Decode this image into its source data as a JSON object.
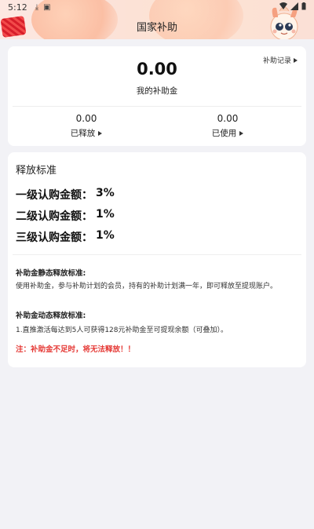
{
  "status_bar": {
    "time": "5:12"
  },
  "header": {
    "title": "国家补助"
  },
  "summary": {
    "history_label": "补助记录",
    "total_amount": "0.00",
    "total_label": "我的补助金",
    "released": {
      "value": "0.00",
      "label": "已释放"
    },
    "used": {
      "value": "0.00",
      "label": "已使用"
    }
  },
  "rules": {
    "title": "释放标准",
    "levels": [
      {
        "label": "一级认购金额：",
        "value": "3%"
      },
      {
        "label": "二级认购金额：",
        "value": "1%"
      },
      {
        "label": "三级认购金额：",
        "value": "1%"
      }
    ],
    "static_heading": "补助金静态释放标准:",
    "static_text": "使用补助金，参与补助计划的会员，持有的补助计划满一年，即可释放至提现账户。",
    "dynamic_heading": "补助金动态释放标准:",
    "dynamic_text": "1.直推激活每达到5人可获得128元补助金至可提现余额（可叠加）。",
    "warning": "注：补助金不足时，将无法释放！！"
  },
  "colors": {
    "background": "#f2f2f6",
    "warning": "#e53935"
  }
}
